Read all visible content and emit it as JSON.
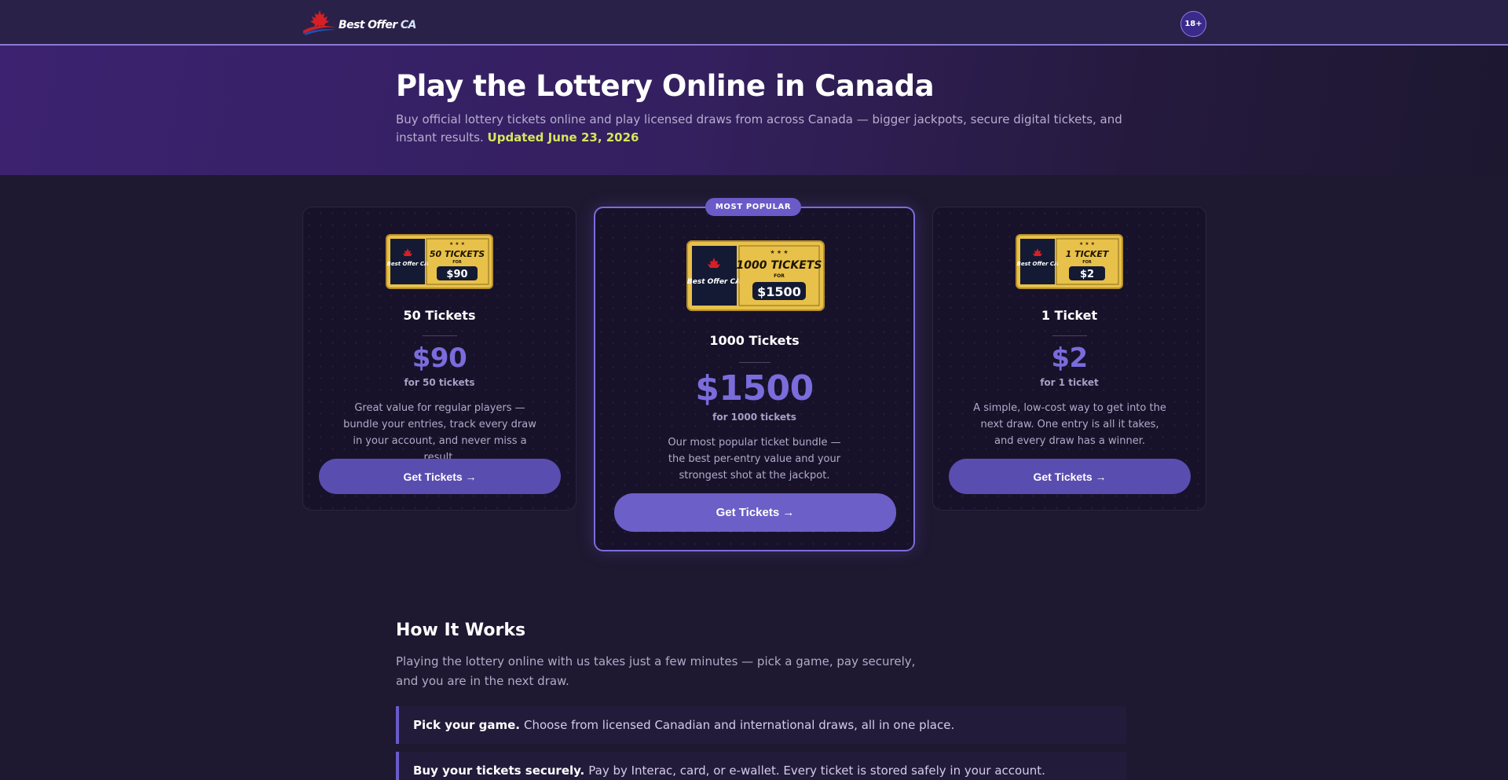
{
  "header": {
    "logo_text_main": "Best Offer",
    "logo_text_ca": "CA",
    "age_badge": "18+"
  },
  "hero": {
    "title": "Play the Lottery Online in Canada",
    "subtitle": "Buy official lottery tickets online and play licensed draws from across Canada — bigger jackpots, secure digital tickets, and instant results.",
    "updated": "Updated June 23, 2026"
  },
  "cards": [
    {
      "ticket_top": "50 TICKETS",
      "ticket_for": "FOR",
      "ticket_price": "$90",
      "ticket_brand": "Best Offer CA",
      "name": "50 Tickets",
      "price": "$90",
      "price_sub": "for 50 tickets",
      "description": "Great value for regular players — bundle your entries, track every draw in your account, and never miss a result.",
      "button": "Get Tickets →"
    },
    {
      "badge": "MOST POPULAR",
      "ticket_top": "1000 TICKETS",
      "ticket_for": "FOR",
      "ticket_price": "$1500",
      "ticket_brand": "Best Offer CA",
      "name": "1000 Tickets",
      "price": "$1500",
      "price_sub": "for 1000 tickets",
      "description": "Our most popular ticket bundle — the best per-entry value and your strongest shot at the jackpot.",
      "button": "Get Tickets →"
    },
    {
      "ticket_top": "1 TICKET",
      "ticket_for": "FOR",
      "ticket_price": "$2",
      "ticket_brand": "Best Offer CA",
      "name": "1 Ticket",
      "price": "$2",
      "price_sub": "for 1 ticket",
      "description": "A simple, low-cost way to get into the next draw. One entry is all it takes, and every draw has a winner.",
      "button": "Get Tickets →"
    }
  ],
  "how": {
    "title": "How It Works",
    "intro": "Playing the lottery online with us takes just a few minutes — pick a game, pay securely, and you are in the next draw.",
    "steps": [
      {
        "strong": "Pick your game.",
        "text": "Choose from licensed Canadian and international draws, all in one place."
      },
      {
        "strong": "Buy your tickets securely.",
        "text": "Pay by Interac, card, or e-wallet. Every ticket is stored safely in your account."
      }
    ]
  },
  "colors": {
    "accent": "#7b6cdc",
    "button": "#5a4db0",
    "updated": "#d6e65a",
    "gold": "#e8c14a"
  }
}
